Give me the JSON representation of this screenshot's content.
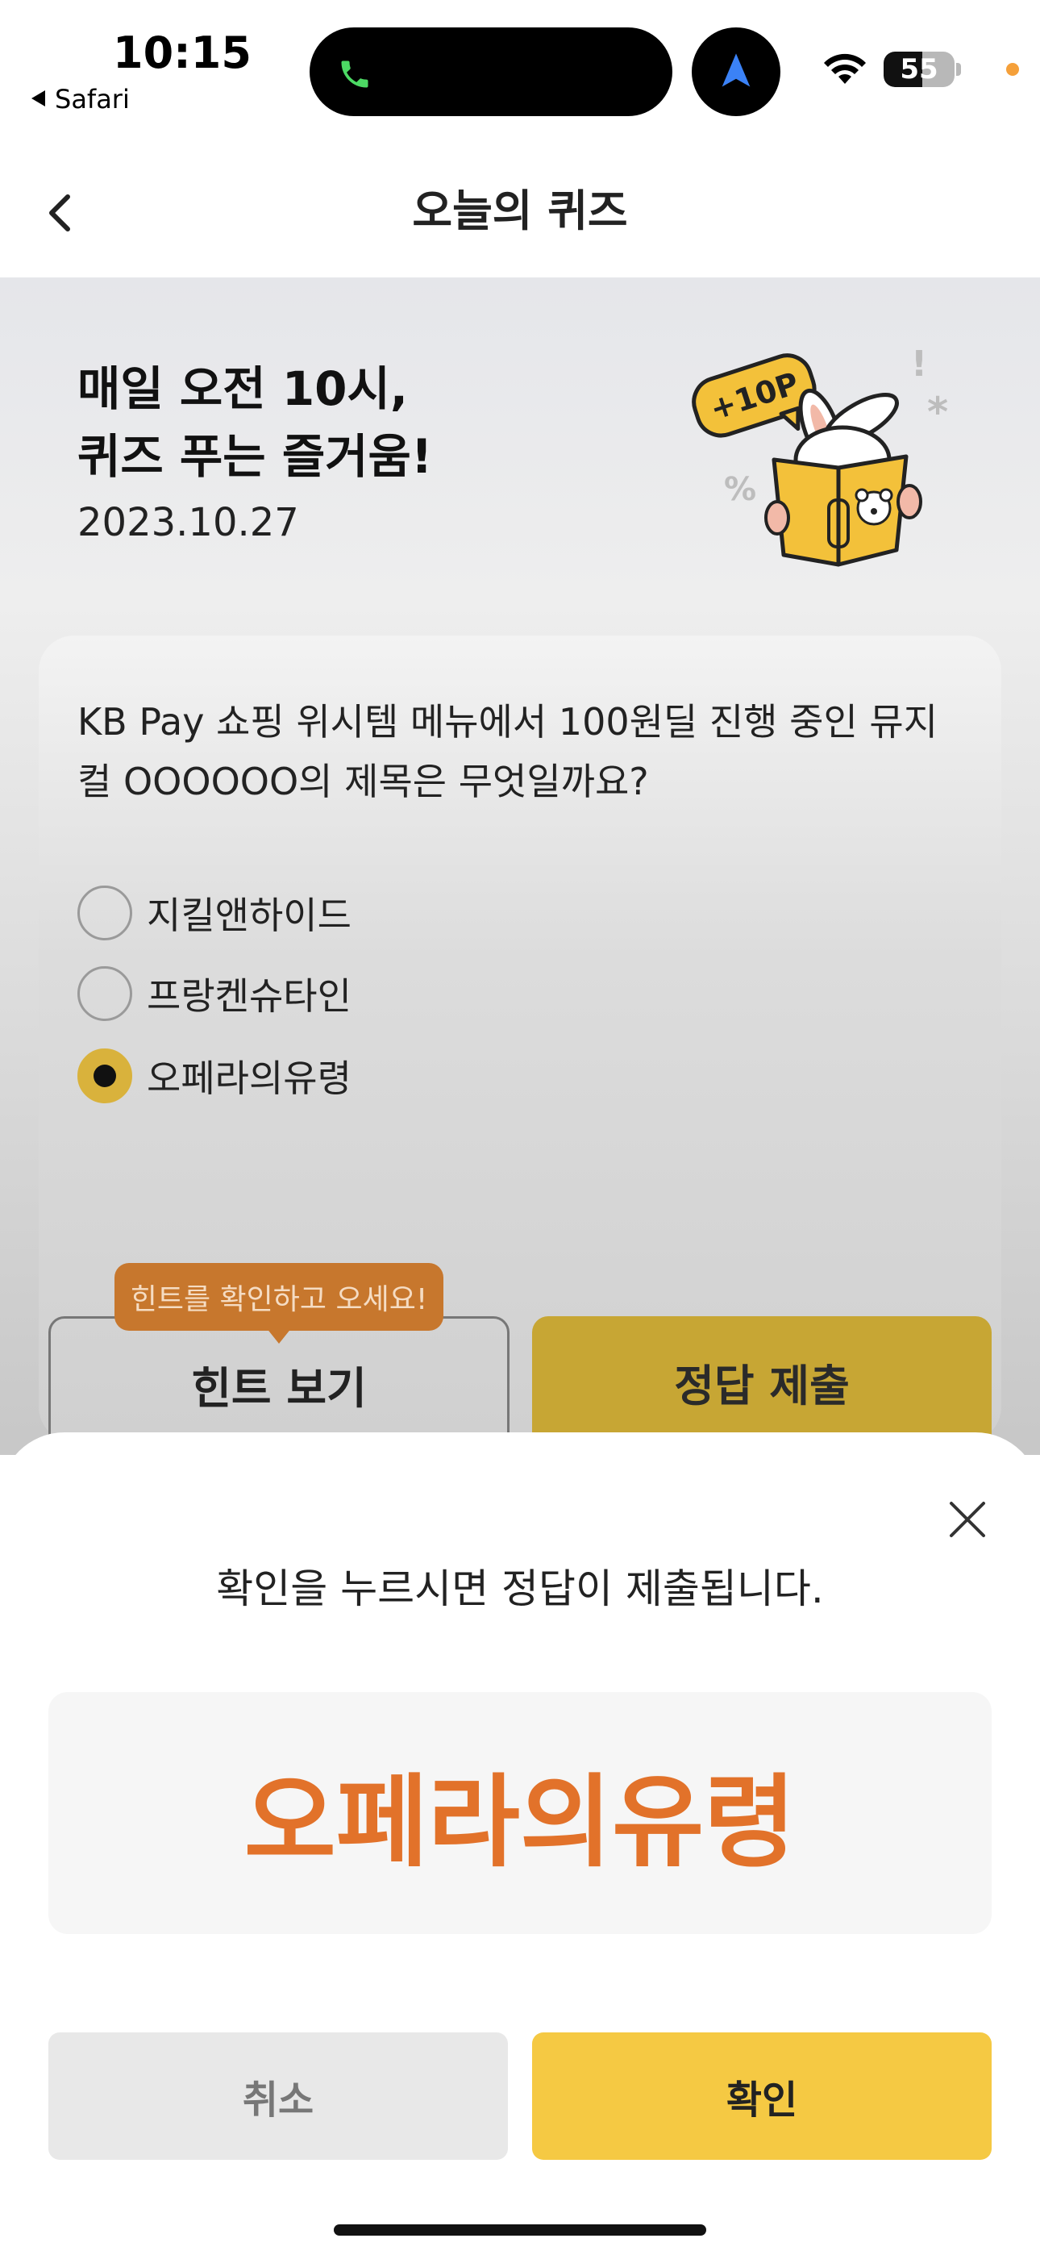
{
  "status_bar": {
    "time": "10:15",
    "back_app": "Safari",
    "battery": "55",
    "battery_level": 0.55,
    "icons": [
      "phone-icon",
      "navigation-arrow-icon",
      "wifi-icon",
      "battery-icon"
    ]
  },
  "header": {
    "title": "오늘의 퀴즈",
    "back_icon": "chevron-left-icon"
  },
  "hero": {
    "headline_line1": "매일 오전 10시,",
    "headline_line2": "퀴즈 푸는 즐거움!",
    "date": "2023.10.27",
    "badge": "+10P"
  },
  "quiz": {
    "question": "KB Pay 쇼핑 위시템 메뉴에서 100원딜 진행 중인 뮤지컬 OOOOOO의 제목은 무엇일까요?",
    "options": [
      {
        "label": "지킬앤하이드",
        "selected": false
      },
      {
        "label": "프랑켄슈타인",
        "selected": false
      },
      {
        "label": "오페라의유령",
        "selected": true
      }
    ],
    "hint_tooltip": "힌트를 확인하고 오세요!",
    "hint_button": "힌트 보기",
    "submit_button": "정답 제출"
  },
  "sheet": {
    "message": "확인을 누르시면 정답이 제출됩니다.",
    "answer": "오페라의유령",
    "cancel_button": "취소",
    "confirm_button": "확인"
  },
  "colors": {
    "accent_yellow": "#f5c943",
    "answer_orange": "#e2722a",
    "tooltip_orange": "#c7772d",
    "radio_selected": "#d9b23c"
  }
}
